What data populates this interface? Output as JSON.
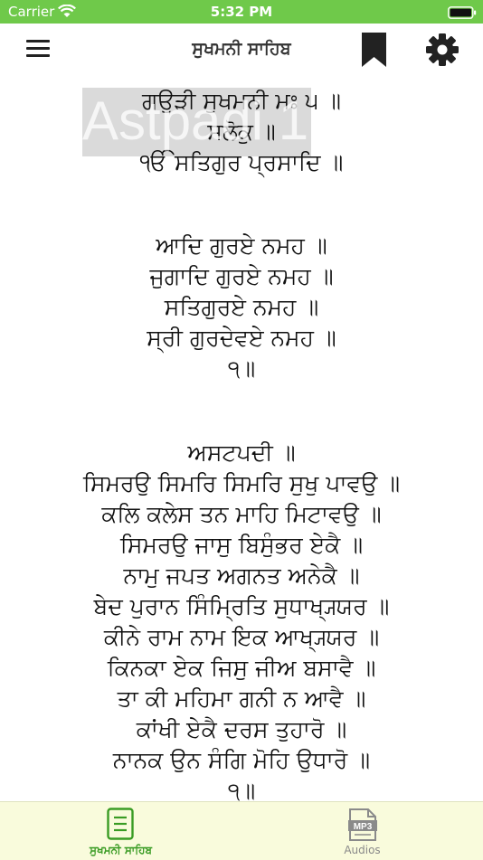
{
  "status_bar": {
    "carrier": "Carrier",
    "time": "5:32 PM"
  },
  "nav": {
    "title": "ਸੁਖਮਨੀ ਸਾਹਿਬ"
  },
  "watermark": "Astpadi 1",
  "content": {
    "lines": [
      "ਗਉੜੀ ਸੁਖਮਨੀ ਮਃ ੫ ॥",
      "ਸਲੋਕੁ ॥",
      "ੴ ਸਤਿਗੁਰ ਪ੍ਰਸਾਦਿ ॥",
      "ਆਦਿ ਗੁਰਏ ਨਮਹ ॥",
      "ਜੁਗਾਦਿ ਗੁਰਏ ਨਮਹ ॥",
      "ਸਤਿਗੁਰਏ ਨਮਹ ॥",
      "ਸ੍ਰੀ ਗੁਰਦੇਵਏ ਨਮਹ ॥",
      "੧॥",
      "ਅਸਟਪਦੀ ॥",
      "ਸਿਮਰਉ ਸਿਮਰਿ ਸਿਮਰਿ ਸੁਖੁ ਪਾਵਉ ॥",
      "ਕਲਿ ਕਲੇਸ ਤਨ ਮਾਹਿ ਮਿਟਾਵਉ ॥",
      "ਸਿਮਰਉ ਜਾਸੁ ਬਿਸੁੰਭਰ ਏਕੈ ॥",
      "ਨਾਮੁ ਜਪਤ ਅਗਨਤ ਅਨੇਕੈ ॥",
      "ਬੇਦ ਪੁਰਾਨ ਸਿੰਮ੍ਰਿਤਿ ਸੁਧਾਖ੍ਯ੍ਯਰ ॥",
      "ਕੀਨੇ ਰਾਮ ਨਾਮ ਇਕ ਆਖ੍ਯ੍ਯਰ ॥",
      "ਕਿਨਕਾ ਏਕ ਜਿਸੁ ਜੀਅ ਬਸਾਵੈ ॥",
      "ਤਾ ਕੀ ਮਹਿਮਾ ਗਨੀ ਨ ਆਵੈ ॥",
      "ਕਾਂਖੀ ਏਕੈ ਦਰਸ ਤੁਹਾਰੋ ॥",
      "ਨਾਨਕ ਉਨ ਸੰਗਿ ਮੋਹਿ ਉਧਾਰੋ ॥",
      "੧॥"
    ]
  },
  "tabs": [
    {
      "label": "ਸੁਖਮਨੀ ਸਾਹਿਬ",
      "icon": "document-icon",
      "active": true
    },
    {
      "label": "Audios",
      "icon": "mp3-file-icon",
      "active": false
    }
  ],
  "colors": {
    "status_bar": "#6fc94a",
    "tab_active": "#3a9c24",
    "tab_bar_bg": "#f9fbdc"
  }
}
